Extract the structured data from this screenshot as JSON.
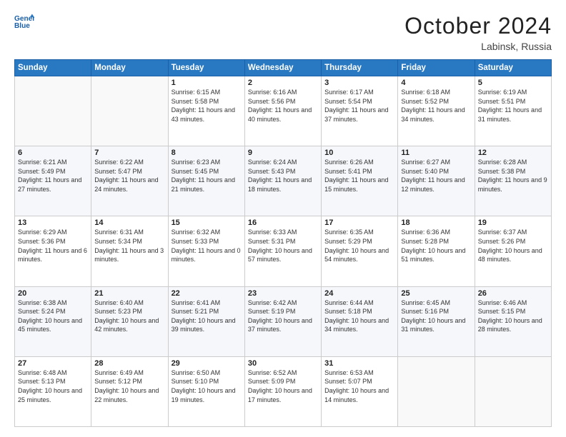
{
  "logo": {
    "line1": "General",
    "line2": "Blue"
  },
  "header": {
    "month": "October 2024",
    "location": "Labinsk, Russia"
  },
  "weekdays": [
    "Sunday",
    "Monday",
    "Tuesday",
    "Wednesday",
    "Thursday",
    "Friday",
    "Saturday"
  ],
  "weeks": [
    [
      {
        "day": "",
        "content": ""
      },
      {
        "day": "",
        "content": ""
      },
      {
        "day": "1",
        "content": "Sunrise: 6:15 AM\nSunset: 5:58 PM\nDaylight: 11 hours and 43 minutes."
      },
      {
        "day": "2",
        "content": "Sunrise: 6:16 AM\nSunset: 5:56 PM\nDaylight: 11 hours and 40 minutes."
      },
      {
        "day": "3",
        "content": "Sunrise: 6:17 AM\nSunset: 5:54 PM\nDaylight: 11 hours and 37 minutes."
      },
      {
        "day": "4",
        "content": "Sunrise: 6:18 AM\nSunset: 5:52 PM\nDaylight: 11 hours and 34 minutes."
      },
      {
        "day": "5",
        "content": "Sunrise: 6:19 AM\nSunset: 5:51 PM\nDaylight: 11 hours and 31 minutes."
      }
    ],
    [
      {
        "day": "6",
        "content": "Sunrise: 6:21 AM\nSunset: 5:49 PM\nDaylight: 11 hours and 27 minutes."
      },
      {
        "day": "7",
        "content": "Sunrise: 6:22 AM\nSunset: 5:47 PM\nDaylight: 11 hours and 24 minutes."
      },
      {
        "day": "8",
        "content": "Sunrise: 6:23 AM\nSunset: 5:45 PM\nDaylight: 11 hours and 21 minutes."
      },
      {
        "day": "9",
        "content": "Sunrise: 6:24 AM\nSunset: 5:43 PM\nDaylight: 11 hours and 18 minutes."
      },
      {
        "day": "10",
        "content": "Sunrise: 6:26 AM\nSunset: 5:41 PM\nDaylight: 11 hours and 15 minutes."
      },
      {
        "day": "11",
        "content": "Sunrise: 6:27 AM\nSunset: 5:40 PM\nDaylight: 11 hours and 12 minutes."
      },
      {
        "day": "12",
        "content": "Sunrise: 6:28 AM\nSunset: 5:38 PM\nDaylight: 11 hours and 9 minutes."
      }
    ],
    [
      {
        "day": "13",
        "content": "Sunrise: 6:29 AM\nSunset: 5:36 PM\nDaylight: 11 hours and 6 minutes."
      },
      {
        "day": "14",
        "content": "Sunrise: 6:31 AM\nSunset: 5:34 PM\nDaylight: 11 hours and 3 minutes."
      },
      {
        "day": "15",
        "content": "Sunrise: 6:32 AM\nSunset: 5:33 PM\nDaylight: 11 hours and 0 minutes."
      },
      {
        "day": "16",
        "content": "Sunrise: 6:33 AM\nSunset: 5:31 PM\nDaylight: 10 hours and 57 minutes."
      },
      {
        "day": "17",
        "content": "Sunrise: 6:35 AM\nSunset: 5:29 PM\nDaylight: 10 hours and 54 minutes."
      },
      {
        "day": "18",
        "content": "Sunrise: 6:36 AM\nSunset: 5:28 PM\nDaylight: 10 hours and 51 minutes."
      },
      {
        "day": "19",
        "content": "Sunrise: 6:37 AM\nSunset: 5:26 PM\nDaylight: 10 hours and 48 minutes."
      }
    ],
    [
      {
        "day": "20",
        "content": "Sunrise: 6:38 AM\nSunset: 5:24 PM\nDaylight: 10 hours and 45 minutes."
      },
      {
        "day": "21",
        "content": "Sunrise: 6:40 AM\nSunset: 5:23 PM\nDaylight: 10 hours and 42 minutes."
      },
      {
        "day": "22",
        "content": "Sunrise: 6:41 AM\nSunset: 5:21 PM\nDaylight: 10 hours and 39 minutes."
      },
      {
        "day": "23",
        "content": "Sunrise: 6:42 AM\nSunset: 5:19 PM\nDaylight: 10 hours and 37 minutes."
      },
      {
        "day": "24",
        "content": "Sunrise: 6:44 AM\nSunset: 5:18 PM\nDaylight: 10 hours and 34 minutes."
      },
      {
        "day": "25",
        "content": "Sunrise: 6:45 AM\nSunset: 5:16 PM\nDaylight: 10 hours and 31 minutes."
      },
      {
        "day": "26",
        "content": "Sunrise: 6:46 AM\nSunset: 5:15 PM\nDaylight: 10 hours and 28 minutes."
      }
    ],
    [
      {
        "day": "27",
        "content": "Sunrise: 6:48 AM\nSunset: 5:13 PM\nDaylight: 10 hours and 25 minutes."
      },
      {
        "day": "28",
        "content": "Sunrise: 6:49 AM\nSunset: 5:12 PM\nDaylight: 10 hours and 22 minutes."
      },
      {
        "day": "29",
        "content": "Sunrise: 6:50 AM\nSunset: 5:10 PM\nDaylight: 10 hours and 19 minutes."
      },
      {
        "day": "30",
        "content": "Sunrise: 6:52 AM\nSunset: 5:09 PM\nDaylight: 10 hours and 17 minutes."
      },
      {
        "day": "31",
        "content": "Sunrise: 6:53 AM\nSunset: 5:07 PM\nDaylight: 10 hours and 14 minutes."
      },
      {
        "day": "",
        "content": ""
      },
      {
        "day": "",
        "content": ""
      }
    ]
  ]
}
